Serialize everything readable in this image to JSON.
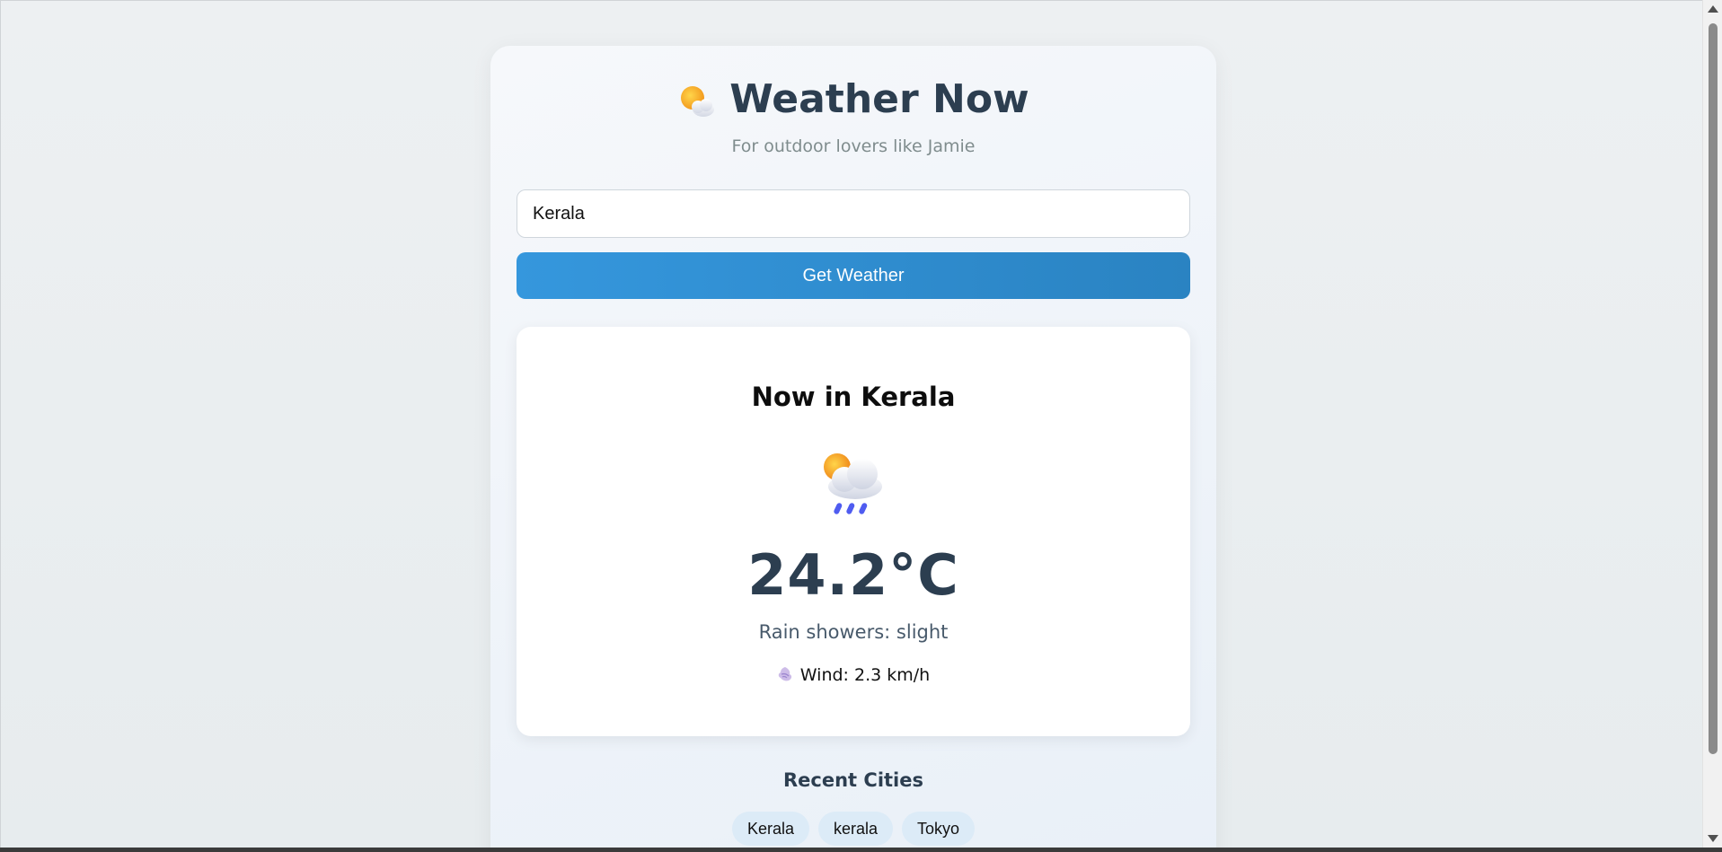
{
  "app": {
    "title": "Weather Now",
    "title_icon": "sun-behind-cloud-icon",
    "subtitle": "For outdoor lovers like Jamie"
  },
  "search": {
    "value": "Kerala",
    "button_label": "Get Weather"
  },
  "weather": {
    "heading": "Now in Kerala",
    "icon": "sun-behind-rain-cloud-icon",
    "temperature": "24.2°C",
    "condition": "Rain showers: slight",
    "wind_icon": "wind-icon",
    "wind": "Wind: 2.3 km/h"
  },
  "recent": {
    "heading": "Recent Cities",
    "cities": [
      "Kerala",
      "kerala",
      "Tokyo"
    ]
  },
  "colors": {
    "accent": "#3498db",
    "title_text": "#2c3e50",
    "chip_bg": "#dcebf7"
  }
}
